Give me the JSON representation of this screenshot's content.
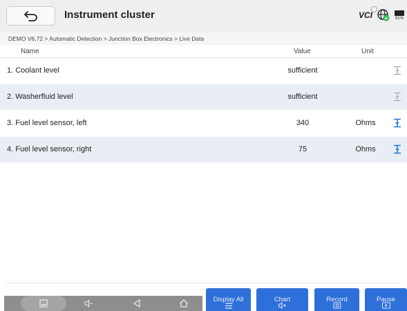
{
  "header": {
    "title": "Instrument cluster",
    "vci_label": "VCI",
    "battery_percent": "81%"
  },
  "breadcrumb": "DEMO V6.72 > Automatic Detection  > Junction Box Electronics > Live Data",
  "table": {
    "columns": {
      "name": "Name",
      "value": "Value",
      "unit": "Unit"
    },
    "rows": [
      {
        "name": "1. Coolant level",
        "value": "sufficient",
        "unit": "",
        "graph_enabled": false
      },
      {
        "name": "2. Washerfluid level",
        "value": "sufficient",
        "unit": "",
        "graph_enabled": false
      },
      {
        "name": "3. Fuel level sensor, left",
        "value": "340",
        "unit": "Ohms",
        "graph_enabled": true
      },
      {
        "name": "4. Fuel level sensor, right",
        "value": "75",
        "unit": "Ohms",
        "graph_enabled": true
      }
    ]
  },
  "buttons": {
    "display_all": "Display All",
    "chart": "Chart",
    "record": "Record",
    "pause": "Pause"
  },
  "colors": {
    "accent": "#2f6fd9",
    "row_alt": "#e9eef4",
    "icon_active": "#1e78d8",
    "icon_disabled": "#a9abaf"
  }
}
